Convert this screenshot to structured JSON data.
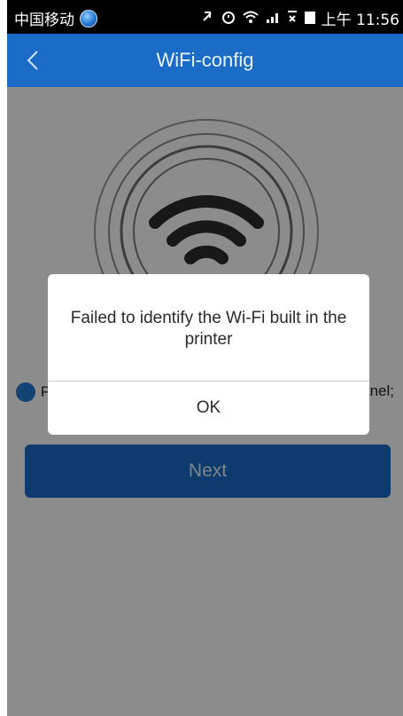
{
  "status_bar": {
    "carrier": "中国移动",
    "time": "上午 11:56",
    "icons": [
      "globe-icon",
      "mute-icon",
      "alarm-icon",
      "wifi-icon",
      "signal-icon",
      "data-icon",
      "battery-icon"
    ]
  },
  "header": {
    "title": "WiFi-config",
    "back_icon": "chevron-left-icon"
  },
  "main": {
    "hero_icon": "wifi-icon",
    "radio_label_start": "P",
    "radio_label_end": "anel;",
    "next_button_label": "Next"
  },
  "dialog": {
    "message": "Failed to identify the Wi-Fi built in the printer",
    "ok_label": "OK"
  },
  "colors": {
    "accent": "#1a6cc6",
    "radio": "#2479d3"
  }
}
